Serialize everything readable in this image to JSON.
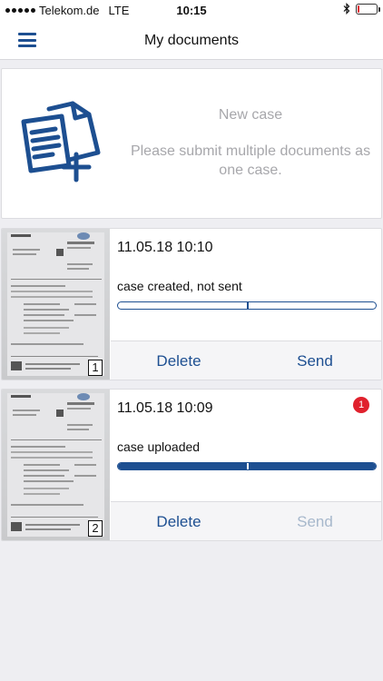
{
  "status_bar": {
    "carrier": "Telekom.de",
    "network": "LTE",
    "time": "10:15",
    "battery_level": 0.12
  },
  "nav": {
    "title": "My documents"
  },
  "new_case": {
    "title": "New case",
    "subtitle": "Please submit multiple documents as one case."
  },
  "cases": [
    {
      "datetime": "11.05.18 10:10",
      "status": "case created, not sent",
      "progress": 0,
      "document_count": "1",
      "delete_label": "Delete",
      "send_label": "Send",
      "send_enabled": true,
      "badge": ""
    },
    {
      "datetime": "11.05.18 10:09",
      "status": "case uploaded",
      "progress": 1,
      "document_count": "2",
      "delete_label": "Delete",
      "send_label": "Send",
      "send_enabled": false,
      "badge": "1"
    }
  ],
  "colors": {
    "accent": "#1d4f91",
    "badge": "#e0212d",
    "muted_text": "#a7a7ab",
    "disabled_action": "#a7b8cc"
  },
  "icons": {
    "menu": "hamburger-menu-icon",
    "new_case": "documents-plus-icon",
    "bluetooth": "bluetooth-icon"
  }
}
